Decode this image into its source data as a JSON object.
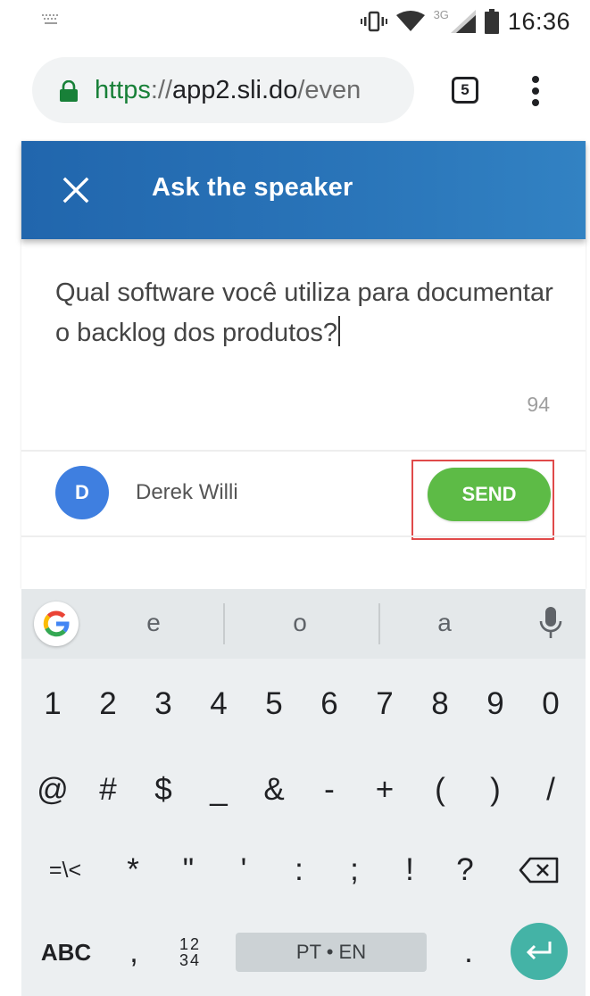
{
  "status_bar": {
    "time": "16:36",
    "network_type": "3G",
    "icons": [
      "notification-keyboard-icon",
      "vibrate-icon",
      "wifi-icon",
      "cell-signal-icon",
      "battery-icon"
    ]
  },
  "browser": {
    "url_scheme": "https",
    "url_separator": "://",
    "url_host": "app2.sli.do",
    "url_path": "/even",
    "tab_count": "5",
    "secure_color": "#188038"
  },
  "dialog": {
    "title": "Ask the speaker",
    "question": "Qual software você utiliza para documentar o backlog dos produtos?",
    "char_remaining": "94",
    "user_initial": "D",
    "user_name": "Derek Willi",
    "send_label": "SEND",
    "header_color": "#2a72b5",
    "send_color": "#5dbb46"
  },
  "keyboard": {
    "suggestions": [
      "e",
      "o",
      "a"
    ],
    "row1": [
      "1",
      "2",
      "3",
      "4",
      "5",
      "6",
      "7",
      "8",
      "9",
      "0"
    ],
    "row2": [
      "@",
      "#",
      "$",
      "_",
      "&",
      "-",
      "+",
      "(",
      ")",
      "/"
    ],
    "row3": [
      "=\\<",
      "*",
      "\"",
      "'",
      ":",
      ";",
      "!",
      "?"
    ],
    "abc_label": "ABC",
    "comma": ",",
    "numpad_top": "12",
    "numpad_bottom": "34",
    "space_label": "PT • EN",
    "period": ".",
    "enter_color": "#44b3a6"
  }
}
